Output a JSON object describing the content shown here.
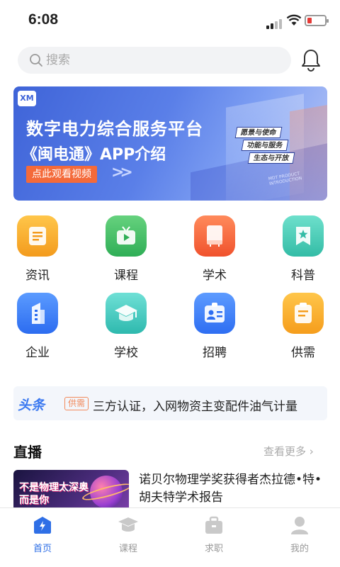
{
  "status": {
    "time": "6:08"
  },
  "search": {
    "placeholder": "搜索"
  },
  "banner": {
    "logo_text": "XM",
    "title_line1": "数字电力综合服务平台",
    "title_line2": "《闽电通》APP介绍",
    "watch_label": "点此观看视频",
    "tags": [
      "愿景与使命",
      "功能与服务",
      "生态与开放"
    ],
    "small_text": "MDT PRODUCT INTRODUCTION"
  },
  "grid": [
    {
      "label": "资讯",
      "icon": "news-icon",
      "color": "#f5a623"
    },
    {
      "label": "课程",
      "icon": "video-course-icon",
      "color": "#34b35a"
    },
    {
      "label": "学术",
      "icon": "academic-book-icon",
      "color": "#f05a30"
    },
    {
      "label": "科普",
      "icon": "science-star-icon",
      "color": "#3cc0a8"
    },
    {
      "label": "企业",
      "icon": "building-icon",
      "color": "#2f6fe6"
    },
    {
      "label": "学校",
      "icon": "graduation-cap-icon",
      "color": "#33bcb0"
    },
    {
      "label": "招聘",
      "icon": "id-card-icon",
      "color": "#2f6fe6"
    },
    {
      "label": "供需",
      "icon": "document-list-icon",
      "color": "#f5a623"
    }
  ],
  "ticker": {
    "brand": "头条",
    "badge": "供需",
    "text": "三方认证，入网物资主变配件油气计量"
  },
  "live": {
    "section_title": "直播",
    "more_label": "查看更多",
    "thumb_text_line1": "不是物理太深奥",
    "thumb_text_line2": "而是你",
    "item_title": "诺贝尔物理学奖获得者杰拉德•特•胡夫特学术报告"
  },
  "tabbar": [
    {
      "label": "首页",
      "icon": "home-lightning-icon",
      "active": true
    },
    {
      "label": "课程",
      "icon": "graduation-cap-icon",
      "active": false
    },
    {
      "label": "求职",
      "icon": "briefcase-icon",
      "active": false
    },
    {
      "label": "我的",
      "icon": "user-icon",
      "active": false
    }
  ],
  "colors": {
    "accent": "#2f6fe6",
    "banner_bg": "#3f64d8",
    "watch_button": "#f46a3a"
  }
}
